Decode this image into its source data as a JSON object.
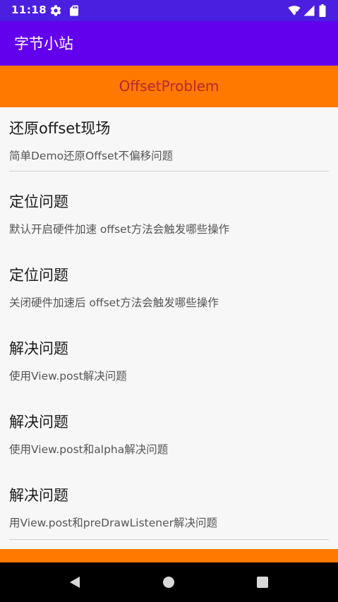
{
  "status_bar": {
    "time": "11:18",
    "left_icons": [
      "gear-icon",
      "sd-card-icon"
    ],
    "right_icons": [
      "wifi-icon",
      "signal-icon",
      "battery-icon"
    ]
  },
  "app_bar": {
    "title": "字节小站"
  },
  "top_banner": {
    "label": "OffsetProblem"
  },
  "list": {
    "items": [
      {
        "title": "还原offset现场",
        "desc": "简单Demo还原Offset不偏移问题"
      },
      {
        "title": "定位问题",
        "desc": "默认开启硬件加速 offset方法会触发哪些操作"
      },
      {
        "title": "定位问题",
        "desc": "关闭硬件加速后 offset方法会触发哪些操作"
      },
      {
        "title": "解决问题",
        "desc": "使用View.post解决问题"
      },
      {
        "title": "解决问题",
        "desc": "使用View.post和alpha解决问题"
      },
      {
        "title": "解决问题",
        "desc": "用View.post和preDrawListener解决问题"
      }
    ]
  },
  "nav_bar": {
    "buttons": [
      "back-icon",
      "home-icon",
      "recents-icon"
    ]
  },
  "colors": {
    "status_bar": "#4a1fe0",
    "app_bar": "#6200ee",
    "banner": "#ff7800",
    "banner_text": "#b42a2a"
  }
}
